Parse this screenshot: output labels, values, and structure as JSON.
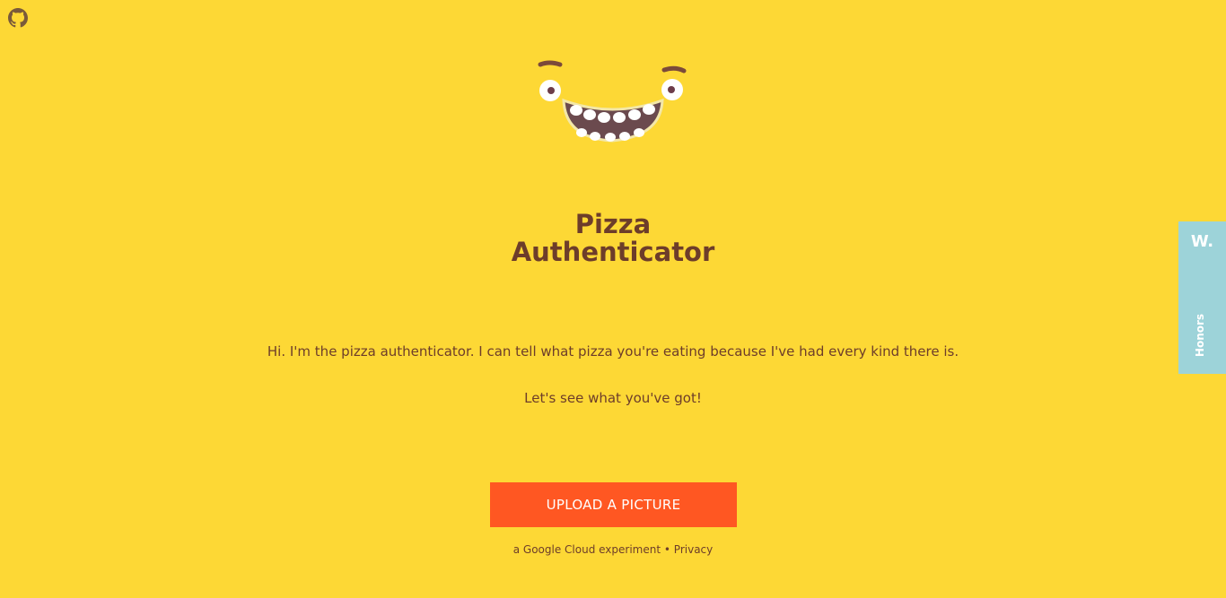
{
  "header": {
    "github_icon": "github-icon"
  },
  "hero": {
    "mascot_icon": "smiling-face-icon",
    "title_line1": "Pizza",
    "title_line2": "Authenticator"
  },
  "main": {
    "intro": "Hi. I'm the pizza authenticator. I can tell what pizza you're eating because I've had every kind there is.",
    "cta_line": "Let's see what you've got!",
    "upload_label": "UPLOAD A PICTURE"
  },
  "footer": {
    "prefix": "a Google Cloud experiment",
    "separator": "•",
    "privacy_label": "Privacy"
  },
  "honors_tab": {
    "logo": "W.",
    "label": "Honors"
  },
  "colors": {
    "background": "#fdd835",
    "text": "#6d3d2a",
    "button": "#ff5722",
    "honors_tab": "#9dd3d9"
  }
}
